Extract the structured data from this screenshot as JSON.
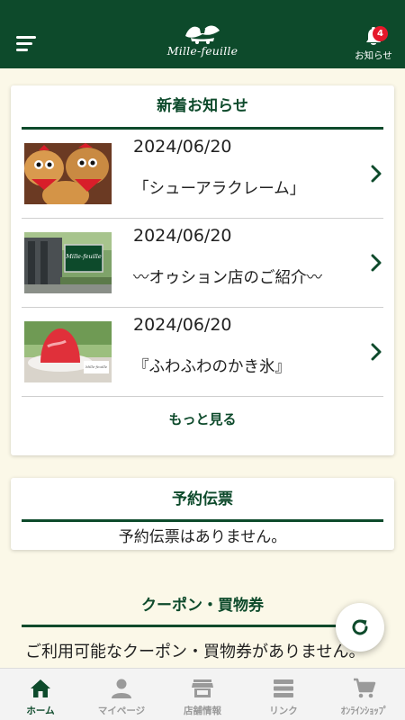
{
  "header": {
    "logo_text": "Mille-feuille",
    "notification_label": "お知らせ",
    "notification_count": "4"
  },
  "news": {
    "title": "新着お知らせ",
    "items": [
      {
        "date": "2024/06/20",
        "title": "「シューアラクレーム」"
      },
      {
        "date": "2024/06/20",
        "title": "〰オゥション店のご紹介〰"
      },
      {
        "date": "2024/06/20",
        "title": "『ふわふわのかき氷』"
      }
    ],
    "more_label": "もっと見る"
  },
  "reservation": {
    "title": "予約伝票",
    "message": "予約伝票はありません。"
  },
  "coupon": {
    "title": "クーポン・買物券",
    "message": "ご利用可能なクーポン・買物券がありません。"
  },
  "tabbar": {
    "tabs": [
      {
        "label": "ホーム",
        "icon": "home-icon",
        "active": true
      },
      {
        "label": "マイページ",
        "icon": "person-icon",
        "active": false
      },
      {
        "label": "店舗情報",
        "icon": "store-icon",
        "active": false
      },
      {
        "label": "リンク",
        "icon": "list-icon",
        "active": false
      },
      {
        "label": "ｵﾝﾗｲﾝｼｮｯﾌﾟ",
        "icon": "cart-icon",
        "active": false
      }
    ]
  },
  "colors": {
    "brand": "#0d4a2b",
    "background": "#fbf8e8",
    "badge": "#e5182b"
  }
}
